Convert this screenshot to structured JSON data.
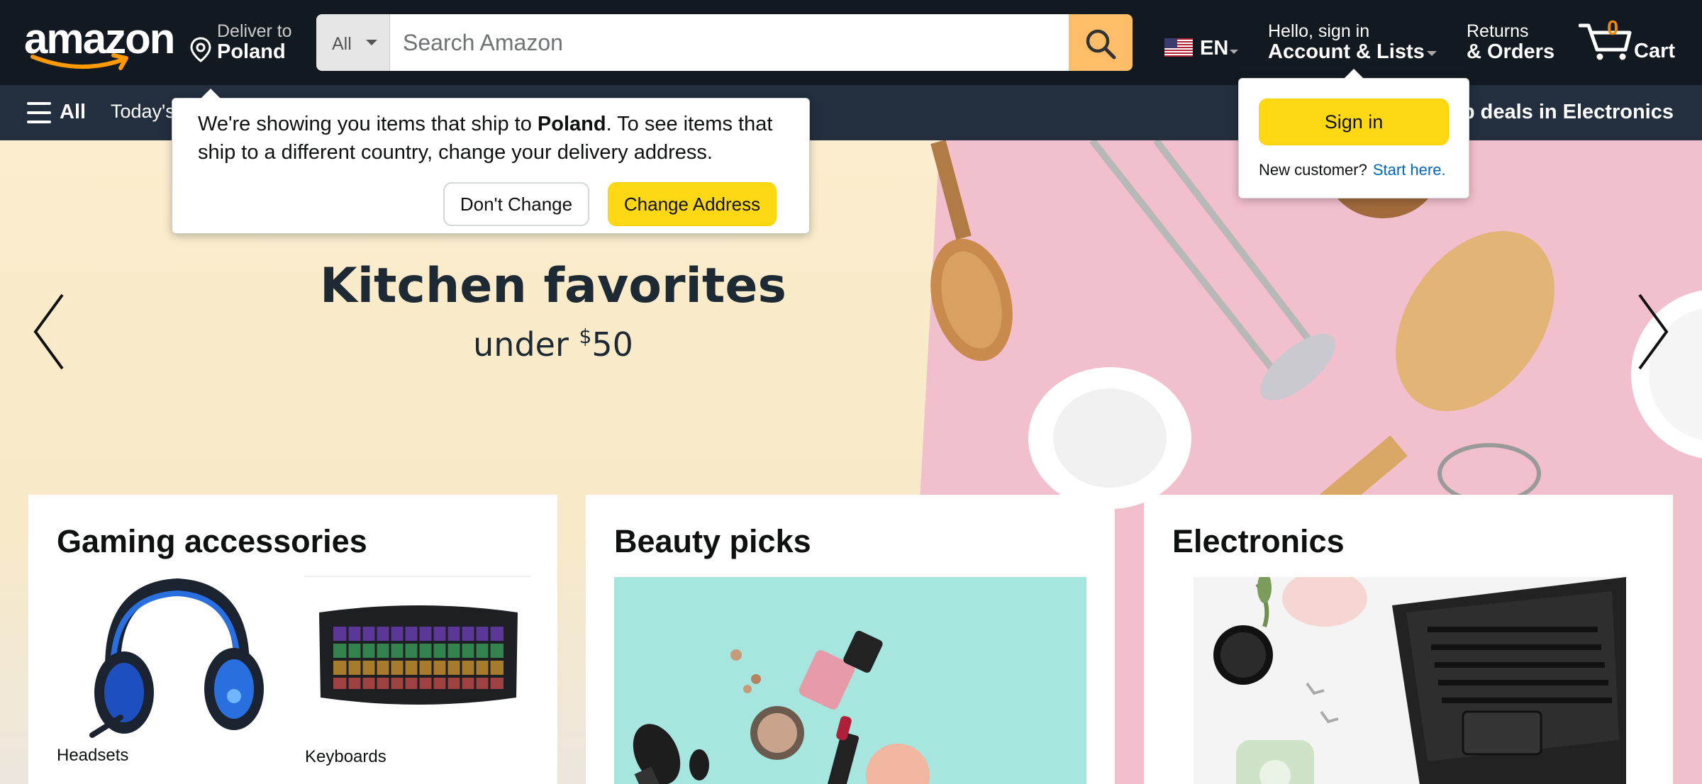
{
  "header": {
    "deliver_label": "Deliver to",
    "deliver_location": "Poland",
    "search": {
      "category": "All",
      "placeholder": "Search Amazon"
    },
    "language": "EN",
    "account_greeting": "Hello, sign in",
    "account_label": "Account & Lists",
    "returns_label": "Returns",
    "orders_label": "& Orders",
    "cart_count": "0",
    "cart_label": "Cart"
  },
  "nav": {
    "all_label": "All",
    "today_label": "Today's",
    "deals_label": "p deals in Electronics"
  },
  "hero": {
    "title": "Kitchen favorites",
    "subtitle_prefix": "under ",
    "subtitle_currency": "$",
    "subtitle_amount": "50"
  },
  "ship_popover": {
    "msg_before": "We're showing you items that ship to ",
    "msg_country": "Poland",
    "msg_after": ". To see items that ship to a different country, change your delivery address.",
    "dont_change": "Don't Change",
    "change_address": "Change Address"
  },
  "signin_popover": {
    "sign_in": "Sign in",
    "new_customer": "New customer?",
    "start_here": "Start here."
  },
  "cards": {
    "gaming": {
      "title": "Gaming accessories",
      "items": [
        {
          "caption": "Headsets"
        },
        {
          "caption": "Keyboards"
        }
      ]
    },
    "beauty": {
      "title": "Beauty picks"
    },
    "electronics": {
      "title": "Electronics"
    }
  },
  "colors": {
    "nav_belt": "#131921",
    "nav_main": "#232f3e",
    "search_button": "#febd69",
    "primary_button": "#ffd814",
    "link": "#0066c0",
    "cart_count": "#f08804"
  }
}
